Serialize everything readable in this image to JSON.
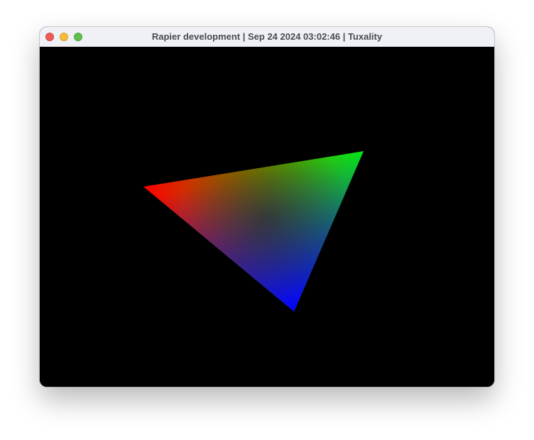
{
  "window": {
    "title": "Rapier development | Sep 24 2024 03:02:46 | Tuxality"
  },
  "traffic_lights": [
    {
      "name": "close",
      "color": "#ee5d55"
    },
    {
      "name": "minimize",
      "color": "#f6bb3a"
    },
    {
      "name": "zoom",
      "color": "#5fc14c"
    }
  ],
  "render": {
    "background": "#000000",
    "triangle_vertex_colors": [
      "#ff0000",
      "#00ff00",
      "#0000ff"
    ]
  }
}
